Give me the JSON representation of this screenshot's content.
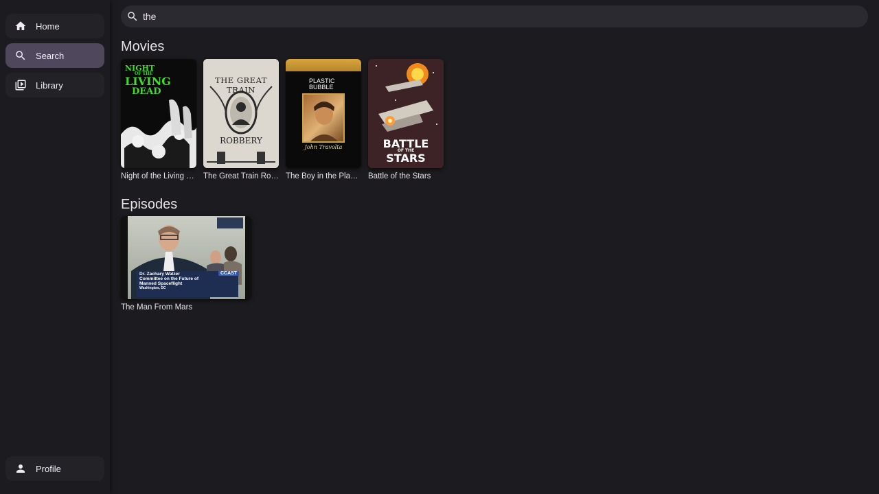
{
  "sidebar": {
    "items": [
      {
        "label": "Home",
        "icon": "home-icon"
      },
      {
        "label": "Search",
        "icon": "search-icon",
        "active": true
      },
      {
        "label": "Library",
        "icon": "library-icon"
      }
    ],
    "profile": {
      "label": "Profile",
      "icon": "person-icon"
    }
  },
  "search": {
    "value": "the"
  },
  "sections": {
    "movies": {
      "title": "Movies",
      "items": [
        {
          "title": "Night of the Living Dead",
          "poster_text": [
            "NIGHT",
            "OF THE",
            "LIVING",
            "DEAD"
          ]
        },
        {
          "title": "The Great Train Robbery",
          "poster_text": [
            "THE GREAT TRAIN",
            "ROBBERY"
          ]
        },
        {
          "title": "The Boy in the Plastic Bubble",
          "poster_text": [
            "PLASTIC",
            "BUBBLE",
            "John Travolta"
          ]
        },
        {
          "title": "Battle of the Stars",
          "poster_text": [
            "BATTLE",
            "OF THE",
            "STARS"
          ]
        }
      ]
    },
    "episodes": {
      "title": "Episodes",
      "items": [
        {
          "title": "The Man From Mars",
          "overlay_lines": [
            "Dr. Zachary Walzer",
            "Committee on the Future of",
            "Manned Spaceflight",
            "Washington, DC"
          ],
          "badge": "CCAST"
        }
      ]
    }
  },
  "colors": {
    "background": "#1c1b1f",
    "nav_active": "#4f475c",
    "search_bg": "#2b2a30"
  }
}
